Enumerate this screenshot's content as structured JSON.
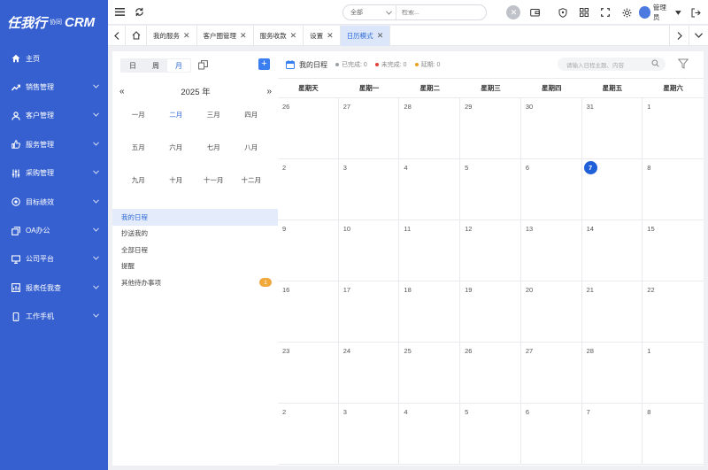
{
  "sidebar": {
    "logo_main": "任我行",
    "logo_small": "协同",
    "logo_crm": "CRM",
    "items": [
      {
        "label": "主页",
        "icon": "home-icon",
        "has_arrow": false
      },
      {
        "label": "销售管理",
        "icon": "trend-icon",
        "has_arrow": true
      },
      {
        "label": "客户管理",
        "icon": "user-icon",
        "has_arrow": true
      },
      {
        "label": "服务管理",
        "icon": "thumb-icon",
        "has_arrow": true
      },
      {
        "label": "采购管理",
        "icon": "sliders-icon",
        "has_arrow": true
      },
      {
        "label": "目标绩效",
        "icon": "target-icon",
        "has_arrow": true
      },
      {
        "label": "OA办公",
        "icon": "copy-icon",
        "has_arrow": true
      },
      {
        "label": "公司平台",
        "icon": "monitor-icon",
        "has_arrow": true
      },
      {
        "label": "报表任我查",
        "icon": "report-icon",
        "has_arrow": true
      },
      {
        "label": "工作手机",
        "icon": "phone-icon",
        "has_arrow": true
      }
    ]
  },
  "topbar": {
    "search_scope": "全部",
    "search_placeholder": "检索...",
    "user_name": "管理员"
  },
  "tabs": [
    {
      "label": "我的服务",
      "active": false
    },
    {
      "label": "客户圈管理",
      "active": false
    },
    {
      "label": "服务收款",
      "active": false
    },
    {
      "label": "设置",
      "active": false
    },
    {
      "label": "日历模式",
      "active": true
    }
  ],
  "left": {
    "views": [
      "日",
      "周",
      "月"
    ],
    "active_view": "月",
    "year_label": "2025 年",
    "prev": "«",
    "next": "»",
    "months": [
      "一月",
      "二月",
      "三月",
      "四月",
      "五月",
      "六月",
      "七月",
      "八月",
      "九月",
      "十月",
      "十一月",
      "十二月"
    ],
    "selected_month": "二月",
    "schedule_items": [
      {
        "label": "我的日程",
        "active": true,
        "badge": ""
      },
      {
        "label": "抄送我的",
        "active": false,
        "badge": ""
      },
      {
        "label": "全部日程",
        "active": false,
        "badge": ""
      },
      {
        "label": "提醒",
        "active": false,
        "badge": ""
      },
      {
        "label": "其他待办事项",
        "active": false,
        "badge": "1"
      }
    ]
  },
  "calendar": {
    "title": "我的日程",
    "legend": [
      {
        "label": "已完成: 0",
        "color": "#9aa0a6"
      },
      {
        "label": "未完成: 0",
        "color": "#e5423a"
      },
      {
        "label": "延期: 0",
        "color": "#f0a020"
      }
    ],
    "search_placeholder": "请输入日程主题、内容",
    "weekdays": [
      "星期天",
      "星期一",
      "星期二",
      "星期三",
      "星期四",
      "星期五",
      "星期六"
    ],
    "days": [
      "26",
      "27",
      "28",
      "29",
      "30",
      "31",
      "1",
      "2",
      "3",
      "4",
      "5",
      "6",
      "7",
      "8",
      "9",
      "10",
      "11",
      "12",
      "13",
      "14",
      "15",
      "16",
      "17",
      "18",
      "19",
      "20",
      "21",
      "22",
      "23",
      "24",
      "25",
      "26",
      "27",
      "28",
      "1",
      "2",
      "3",
      "4",
      "5",
      "6",
      "7",
      "8"
    ],
    "today_index": 12
  }
}
